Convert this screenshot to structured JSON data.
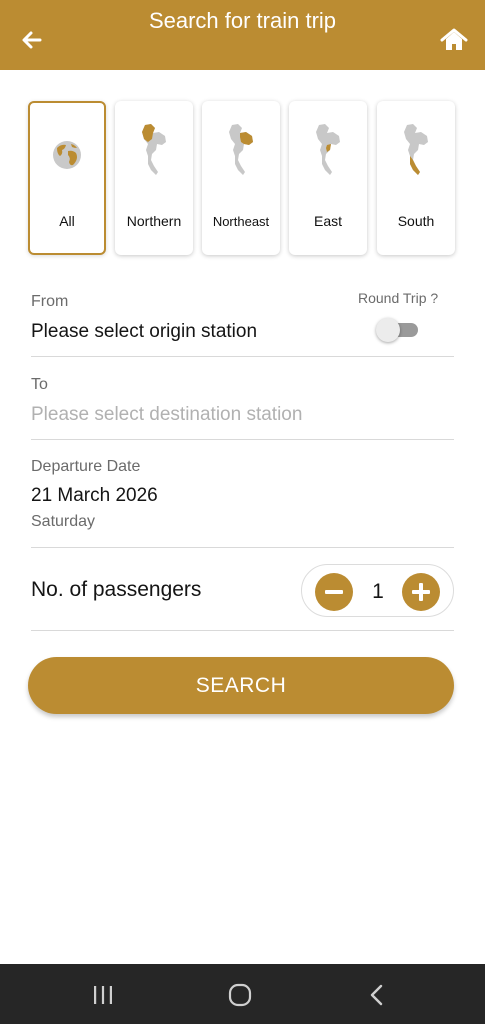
{
  "header": {
    "title": "Search for train trip",
    "back_icon": "arrow-left-icon",
    "home_icon": "home-icon",
    "color": "#bb8c32"
  },
  "regions": [
    {
      "label": "All",
      "icon": "globe-icon",
      "selected": true
    },
    {
      "label": "Northern",
      "icon": "thailand-north-map-icon",
      "selected": false
    },
    {
      "label": "Northeast",
      "icon": "thailand-northeast-map-icon",
      "selected": false
    },
    {
      "label": "East",
      "icon": "thailand-east-map-icon",
      "selected": false
    },
    {
      "label": "South",
      "icon": "thailand-south-map-icon",
      "selected": false
    }
  ],
  "from": {
    "label": "From",
    "value": "Please select origin station"
  },
  "round_trip": {
    "label": "Round Trip ?",
    "enabled": false
  },
  "to": {
    "label": "To",
    "placeholder": "Please select destination station"
  },
  "departure": {
    "label": "Departure Date",
    "date": "21 March 2026",
    "weekday": "Saturday"
  },
  "passengers": {
    "label": "No. of passengers",
    "count": "1",
    "minus_icon": "minus-icon",
    "plus_icon": "plus-icon"
  },
  "search": {
    "label": "SEARCH"
  },
  "navbar": {
    "items": [
      "recent-apps-icon",
      "home-circle-icon",
      "back-chevron-icon"
    ]
  }
}
